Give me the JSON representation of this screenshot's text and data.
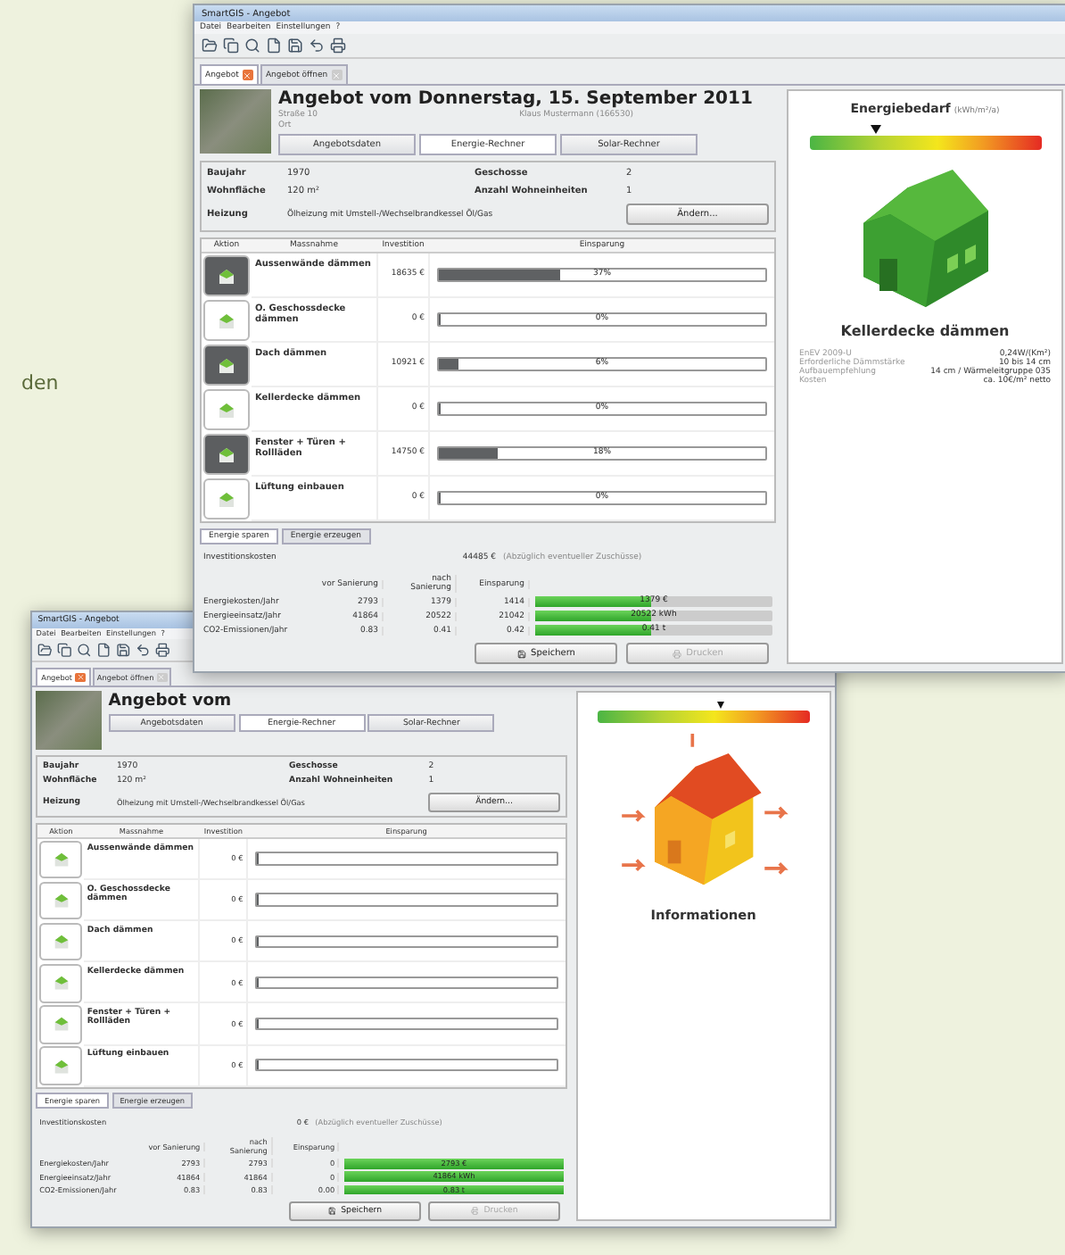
{
  "page_text": "den",
  "back_window": {
    "title": "SmartGIS - Angebot",
    "menu": [
      "Datei",
      "Bearbeiten",
      "Einstellungen",
      "?"
    ],
    "doc_tabs": [
      {
        "label": "Angebot",
        "selected": true
      },
      {
        "label": "Angebot öffnen",
        "selected": false
      }
    ],
    "offer": {
      "title": "Angebot vom"
    },
    "sub_tabs": [
      {
        "label": "Angebotsdaten",
        "selected": false
      },
      {
        "label": "Energie-Rechner",
        "selected": true
      },
      {
        "label": "Solar-Rechner",
        "selected": false
      }
    ],
    "facts": [
      {
        "label": "Baujahr",
        "value": "1970",
        "label2": "Geschosse",
        "value2": "2"
      },
      {
        "label": "Wohnfläche",
        "value": "120 m²",
        "label2": "Anzahl Wohneinheiten",
        "value2": "1"
      },
      {
        "label": "Heizung",
        "value": "Ölheizung mit Umstell-/Wechselbrandkessel Öl/Gas",
        "button": "Ändern..."
      }
    ],
    "columns": [
      "Aktion",
      "Massnahme",
      "Investition",
      "Einsparung"
    ],
    "measures": [
      {
        "name": "Aussenwände dämmen",
        "investment": "0 €",
        "level": 0,
        "active": false
      },
      {
        "name": "O. Geschossdecke dämmen",
        "investment": "0 €",
        "level": 0,
        "active": false
      },
      {
        "name": "Dach dämmen",
        "investment": "0 €",
        "level": 0,
        "active": false
      },
      {
        "name": "Kellerdecke dämmen",
        "investment": "0 €",
        "level": 0,
        "active": false
      },
      {
        "name": "Fenster + Türen + Rollläden",
        "investment": "0 €",
        "level": 0,
        "active": false
      },
      {
        "name": "Lüftung einbauen",
        "investment": "0 €",
        "level": 0,
        "active": false
      }
    ],
    "bottom_tabs": [
      {
        "label": "Energie sparen",
        "selected": true
      },
      {
        "label": "Energie erzeugen",
        "selected": false
      }
    ],
    "investment": {
      "label": "Investitionskosten",
      "value": "0 €",
      "note": "(Abzüglich eventueller Zuschüsse)"
    },
    "summary": {
      "columns": [
        "vor Sanierung",
        "nach Sanierung",
        "Einsparung"
      ],
      "rows": [
        {
          "label": "Energiekosten/Jahr",
          "before": "2793",
          "after": "2793",
          "saving": "0",
          "level": 1,
          "bar_label": "2793 €"
        },
        {
          "label": "Energieeinsatz/Jahr",
          "before": "41864",
          "after": "41864",
          "saving": "0",
          "level": 1,
          "bar_label": "41864 kWh"
        },
        {
          "label": "CO2-Emissionen/Jahr",
          "before": "0.83",
          "after": "0.83",
          "saving": "0.00",
          "level": 1,
          "bar_label": "0.83 t"
        }
      ]
    },
    "buttons": [
      {
        "label": "Speichern",
        "disabled": false
      },
      {
        "label": "Drucken",
        "disabled": true
      }
    ],
    "side": {
      "scale": {
        "level": 0.59
      },
      "kind": "heat",
      "heading": "Informationen"
    }
  },
  "front_window": {
    "title": "SmartGIS - Angebot",
    "menu": [
      "Datei",
      "Bearbeiten",
      "Einstellungen",
      "?"
    ],
    "doc_tabs": [
      {
        "label": "Angebot",
        "selected": true
      },
      {
        "label": "Angebot öffnen",
        "selected": false
      }
    ],
    "offer": {
      "title": "Angebot vom Donnerstag, 15. September 2011",
      "street": "Straße 10",
      "city": "Ort",
      "customer": "Klaus Mustermann (166530)"
    },
    "sub_tabs": [
      {
        "label": "Angebotsdaten",
        "selected": false
      },
      {
        "label": "Energie-Rechner",
        "selected": true
      },
      {
        "label": "Solar-Rechner",
        "selected": false
      }
    ],
    "facts": [
      {
        "label": "Baujahr",
        "value": "1970",
        "label2": "Geschosse",
        "value2": "2"
      },
      {
        "label": "Wohnfläche",
        "value": "120 m²",
        "label2": "Anzahl Wohneinheiten",
        "value2": "1"
      },
      {
        "label": "Heizung",
        "value": "Ölheizung mit Umstell-/Wechselbrandkessel Öl/Gas",
        "button": "Ändern..."
      }
    ],
    "columns": [
      "Aktion",
      "Massnahme",
      "Investition",
      "Einsparung"
    ],
    "measures": [
      {
        "name": "Aussenwände dämmen",
        "investment": "18635 €",
        "level": 0.37,
        "saving": "37%",
        "active": true
      },
      {
        "name": "O. Geschossdecke dämmen",
        "investment": "0 €",
        "level": 0,
        "saving": "0%",
        "active": false
      },
      {
        "name": "Dach dämmen",
        "investment": "10921 €",
        "level": 0.06,
        "saving": "6%",
        "active": true
      },
      {
        "name": "Kellerdecke dämmen",
        "investment": "0 €",
        "level": 0,
        "saving": "0%",
        "active": false
      },
      {
        "name": "Fenster + Türen + Rollläden",
        "investment": "14750 €",
        "level": 0.18,
        "saving": "18%",
        "active": true
      },
      {
        "name": "Lüftung einbauen",
        "investment": "0 €",
        "level": 0,
        "saving": "0%",
        "active": false
      }
    ],
    "bottom_tabs": [
      {
        "label": "Energie sparen",
        "selected": true
      },
      {
        "label": "Energie erzeugen",
        "selected": false
      }
    ],
    "investment": {
      "label": "Investitionskosten",
      "value": "44485 €",
      "note": "(Abzüglich eventueller Zuschüsse)"
    },
    "summary": {
      "columns": [
        "vor Sanierung",
        "nach Sanierung",
        "Einsparung"
      ],
      "rows": [
        {
          "label": "Energiekosten/Jahr",
          "before": "2793",
          "after": "1379",
          "saving": "1414",
          "level": 0.49,
          "bar_label": "1379 €"
        },
        {
          "label": "Energieeinsatz/Jahr",
          "before": "41864",
          "after": "20522",
          "saving": "21042",
          "level": 0.49,
          "bar_label": "20522 kWh"
        },
        {
          "label": "CO2-Emissionen/Jahr",
          "before": "0.83",
          "after": "0.41",
          "saving": "0.42",
          "level": 0.49,
          "bar_label": "0.41 t"
        }
      ]
    },
    "buttons": [
      {
        "label": "Speichern",
        "disabled": false
      },
      {
        "label": "Drucken",
        "disabled": true
      }
    ],
    "side": {
      "title": "Energiebedarf",
      "unit": "(kWh/m²/a)",
      "scale": {
        "level": 0.29
      },
      "kind": "green",
      "heading": "Kellerdecke dämmen",
      "details": [
        {
          "label": "EnEV 2009-U",
          "value": "0,24W/(Km²)"
        },
        {
          "label": "Erforderliche Dämmstärke",
          "value": "10 bis 14 cm"
        },
        {
          "label": "Aufbauempfehlung",
          "value": "14 cm / Wärmeleitgruppe 035"
        },
        {
          "label": "Kosten",
          "value": "ca. 10€/m² netto"
        }
      ]
    }
  }
}
